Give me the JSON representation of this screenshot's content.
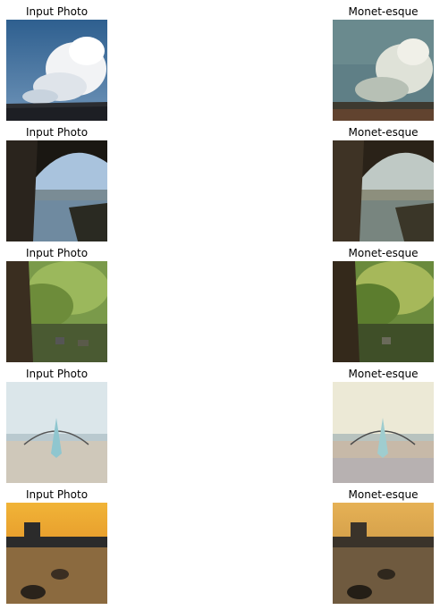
{
  "rows": [
    {
      "left_title": "Input Photo",
      "right_title": "Monet-esque"
    },
    {
      "left_title": "Input Photo",
      "right_title": "Monet-esque"
    },
    {
      "left_title": "Input Photo",
      "right_title": "Monet-esque"
    },
    {
      "left_title": "Input Photo",
      "right_title": "Monet-esque"
    },
    {
      "left_title": "Input Photo",
      "right_title": "Monet-esque"
    }
  ]
}
